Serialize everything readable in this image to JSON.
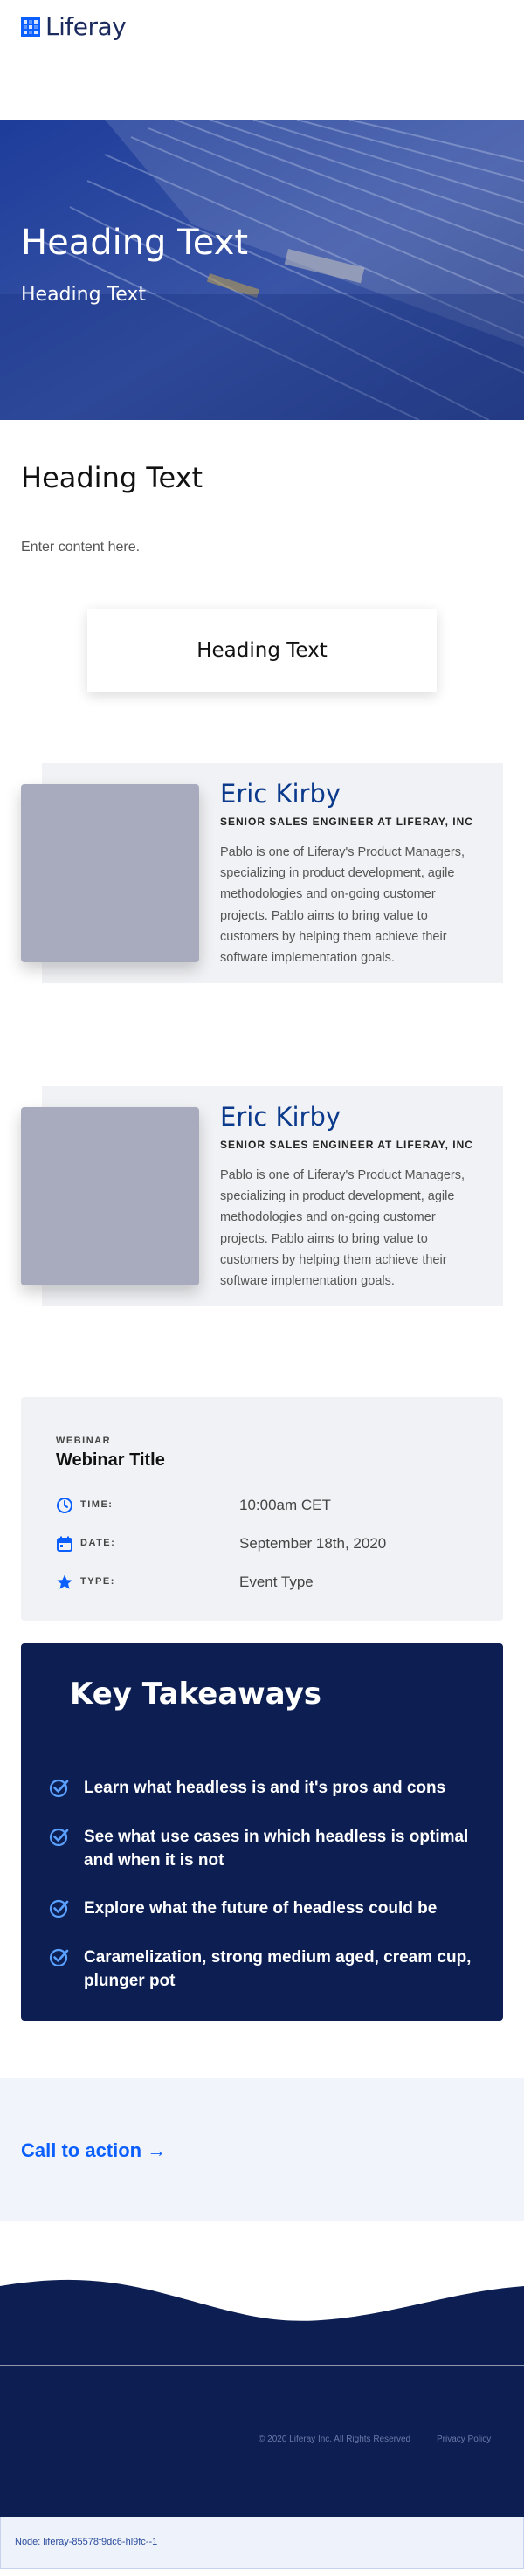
{
  "header": {
    "logo_text": "Liferay"
  },
  "hero": {
    "title": "Heading Text",
    "subtitle": "Heading Text"
  },
  "section": {
    "heading": "Heading Text",
    "content": "Enter content here."
  },
  "card": {
    "heading": "Heading Text"
  },
  "profiles": [
    {
      "name": "Eric Kirby",
      "role": "SENIOR SALES ENGINEER AT LIFERAY, INC",
      "bio": "Pablo is one of Liferay's Product Managers, specializing in product development, agile methodologies and on-going customer projects. Pablo aims to bring value to customers by helping them achieve their software implementation goals."
    },
    {
      "name": "Eric Kirby",
      "role": "SENIOR SALES ENGINEER AT LIFERAY, INC",
      "bio": "Pablo is one of Liferay's Product Managers, specializing in product development, agile methodologies and on-going customer projects. Pablo aims to bring value to customers by helping them achieve their software implementation goals."
    }
  ],
  "webinar": {
    "kicker": "WEBINAR",
    "title": "Webinar Title",
    "rows": [
      {
        "label": "TIME:",
        "value": "10:00am CET",
        "icon": "clock-icon"
      },
      {
        "label": "DATE:",
        "value": "September 18th, 2020",
        "icon": "calendar-icon"
      },
      {
        "label": "TYPE:",
        "value": "Event Type",
        "icon": "star-icon"
      }
    ]
  },
  "takeaways": {
    "title": "Key Takeaways",
    "items": [
      "Learn what headless is and it's pros and cons",
      "See what use cases in which headless is optimal and when it is not",
      "Explore what the future of headless could be",
      "Caramelization, strong medium aged, cream cup, plunger pot"
    ]
  },
  "cta": {
    "label": "Call to action",
    "arrow": "→"
  },
  "footer": {
    "copyright": "© 2020 Liferay Inc. All Rights Reserved",
    "privacy": "Privacy Policy",
    "node": "Node: liferay-85578f9dc6-hl9fc--1"
  },
  "colors": {
    "brand": "#0b5fff",
    "navy": "#0d1f52",
    "profile_name": "#0b3a8c",
    "panel": "#f1f2f5"
  }
}
